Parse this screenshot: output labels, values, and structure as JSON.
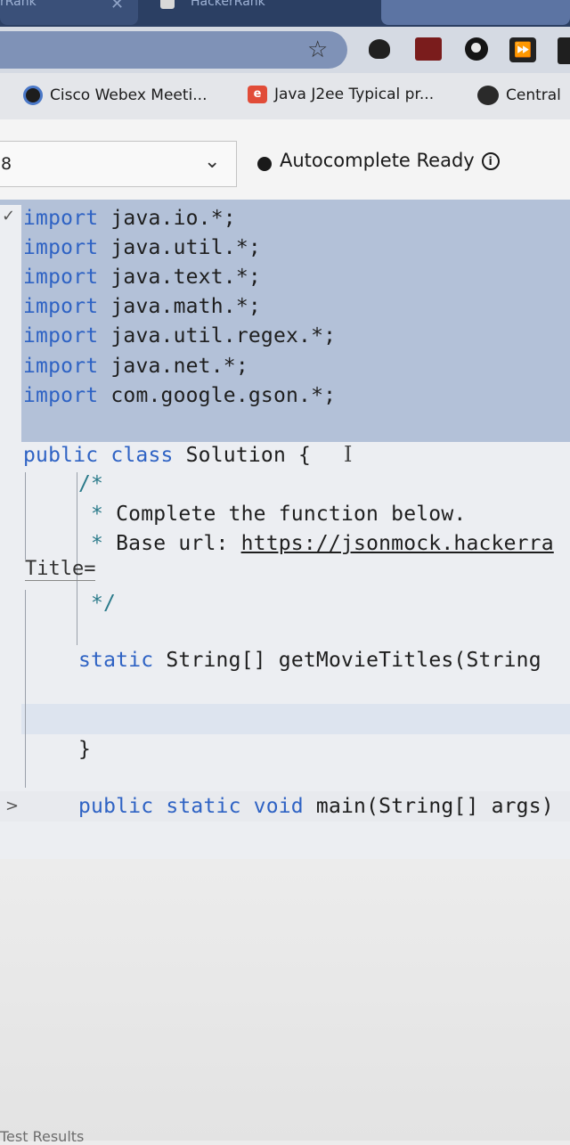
{
  "browser": {
    "tabs": [
      {
        "title": "rRank"
      },
      {
        "title": "HackerRank"
      }
    ],
    "bookmarks": [
      {
        "label": "Cisco Webex Meeti...",
        "icon": "webex-icon"
      },
      {
        "label": "Java J2ee Typical pr...",
        "icon": "edge-e-icon"
      },
      {
        "label": "Central",
        "icon": "globe-icon"
      }
    ]
  },
  "editor": {
    "language_value": "8",
    "status": "Autocomplete Ready",
    "title_marker": "Title=",
    "code": {
      "imports": [
        {
          "kw": "import",
          "rest": " java.io.*;"
        },
        {
          "kw": "import",
          "rest": " java.util.*;"
        },
        {
          "kw": "import",
          "rest": " java.text.*;"
        },
        {
          "kw": "import",
          "rest": " java.math.*;"
        },
        {
          "kw": "import",
          "rest": " java.util.regex.*;"
        },
        {
          "kw": "import",
          "rest": " java.net.*;"
        },
        {
          "kw": "import",
          "rest": " com.google.gson.*;"
        }
      ],
      "class_kw": "public class",
      "class_rest": " Solution {",
      "comment_open": "/*",
      "comment_1_star": "*",
      "comment_1": " Complete the function below.",
      "comment_2_star": "*",
      "comment_2_prefix": " Base url: ",
      "comment_2_url": "https://jsonmock.hackerra",
      "comment_close": "*/",
      "method_kw": "static",
      "method_rest": " String[] getMovieTitles(String",
      "close_brace": "}",
      "main_kw": "public static void",
      "main_rest": " main(String[] args)"
    }
  },
  "footer": {
    "results_label": "Test Results"
  },
  "colors": {
    "keyword": "#2f63c4",
    "comment": "#2a7a8a",
    "selection": "#b3c1d8"
  }
}
